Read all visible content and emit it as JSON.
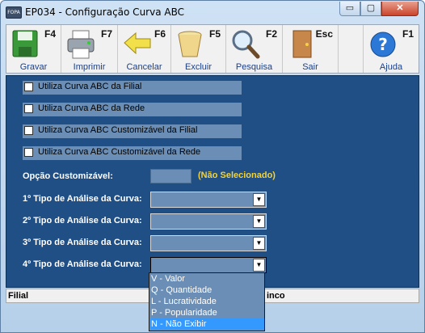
{
  "window": {
    "title": "EP034 - Configuração Curva ABC",
    "min_glyph": "▭",
    "max_glyph": "▢",
    "close_glyph": "✕",
    "icon_text": "FOPA"
  },
  "toolbar": [
    {
      "label": "Gravar",
      "key": "F4",
      "icon": "floppy-save-icon"
    },
    {
      "label": "Imprimir",
      "key": "F7",
      "icon": "printer-icon"
    },
    {
      "label": "Cancelar",
      "key": "F6",
      "icon": "arrow-left-icon"
    },
    {
      "label": "Excluir",
      "key": "F5",
      "icon": "trash-bin-icon"
    },
    {
      "label": "Pesquisa",
      "key": "F2",
      "icon": "magnifier-icon"
    },
    {
      "label": "Sair",
      "key": "Esc",
      "icon": "door-exit-icon"
    },
    {
      "label": "Ajuda",
      "key": "F1",
      "icon": "help-icon"
    }
  ],
  "checkboxes": [
    {
      "label": "Utiliza Curva ABC da Filial",
      "checked": false
    },
    {
      "label": "Utiliza Curva ABC da Rede",
      "checked": false
    },
    {
      "label": "Utiliza Curva ABC Customizável da Filial",
      "checked": false
    },
    {
      "label": "Utiliza Curva ABC Customizável da Rede",
      "checked": false
    }
  ],
  "opcao_customizavel": {
    "label": "Opção Customizável:",
    "value": "",
    "status": "(Não Selecionado)"
  },
  "tipos_analise": [
    {
      "label": "1º Tipo de Análise da Curva:",
      "value": ""
    },
    {
      "label": "2º Tipo de Análise da Curva:",
      "value": ""
    },
    {
      "label": "3º Tipo de Análise da Curva:",
      "value": ""
    },
    {
      "label": "4º Tipo de Análise da Curva:",
      "value": ""
    }
  ],
  "dropdown_arrow": "▼",
  "dropdown_options": [
    "V - Valor",
    "Q - Quantidade",
    "L - Lucratividade",
    "P - Popularidade",
    "N - Não Exibir"
  ],
  "dropdown_highlighted_index": 4,
  "statusbar": {
    "left": "Filial",
    "right": "inco"
  },
  "colors": {
    "panel": "#1f4f84",
    "field": "#6a8eb6",
    "highlight": "#3399ff",
    "status_text": "#f2d33a"
  }
}
